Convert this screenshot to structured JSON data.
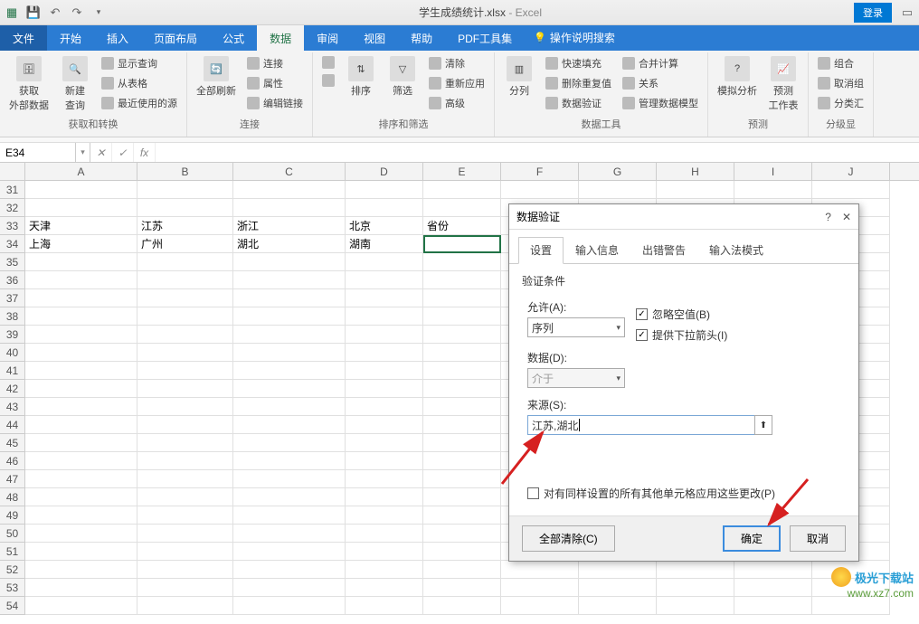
{
  "title": {
    "doc": "学生成绩统计.xlsx",
    "app": "Excel"
  },
  "login": "登录",
  "tabs": {
    "file": "文件",
    "home": "开始",
    "insert": "插入",
    "layout": "页面布局",
    "formulas": "公式",
    "data": "数据",
    "review": "审阅",
    "view": "视图",
    "help": "帮助",
    "pdf": "PDF工具集",
    "tellme": "操作说明搜索"
  },
  "ribbon": {
    "g1": {
      "label": "获取和转换",
      "getExternal": "获取\n外部数据",
      "newQuery": "新建\n查询",
      "showQueries": "显示查询",
      "fromTable": "从表格",
      "recentSources": "最近使用的源"
    },
    "g2": {
      "label": "连接",
      "refreshAll": "全部刷新",
      "connections": "连接",
      "properties": "属性",
      "editLinks": "编辑链接"
    },
    "g3": {
      "label": "排序和筛选",
      "sortAZ": "A↓Z",
      "sortZA": "Z↓A",
      "sort": "排序",
      "filter": "筛选",
      "clear": "清除",
      "reapply": "重新应用",
      "advanced": "高级"
    },
    "g4": {
      "label": "数据工具",
      "textToCols": "分列",
      "flashFill": "快速填充",
      "removeDup": "删除重复值",
      "dataValidation": "数据验证",
      "consolidate": "合并计算",
      "relations": "关系",
      "manageModel": "管理数据模型"
    },
    "g5": {
      "label": "预测",
      "whatIf": "模拟分析",
      "forecast": "预测\n工作表"
    },
    "g6": {
      "label": "分级显",
      "group": "组合",
      "ungroup": "取消组",
      "subtotal": "分类汇"
    }
  },
  "namebox": "E34",
  "columns": [
    "A",
    "B",
    "C",
    "D",
    "E",
    "F",
    "G",
    "H",
    "I",
    "J"
  ],
  "rows": {
    "31": [
      "",
      "",
      "",
      "",
      "",
      "",
      "",
      "",
      "",
      ""
    ],
    "32": [
      "",
      "",
      "",
      "",
      "",
      "",
      "",
      "",
      "",
      ""
    ],
    "33": [
      "天津",
      "江苏",
      "浙江",
      "北京",
      "省份",
      "",
      "",
      "",
      "",
      ""
    ],
    "34": [
      "上海",
      "广州",
      "湖北",
      "湖南",
      "",
      "",
      "",
      "",
      "",
      ""
    ],
    "35": [
      "",
      "",
      "",
      "",
      "",
      "",
      "",
      "",
      "",
      ""
    ],
    "36": [
      "",
      "",
      "",
      "",
      "",
      "",
      "",
      "",
      "",
      ""
    ],
    "37": [
      "",
      "",
      "",
      "",
      "",
      "",
      "",
      "",
      "",
      ""
    ],
    "38": [
      "",
      "",
      "",
      "",
      "",
      "",
      "",
      "",
      "",
      ""
    ],
    "39": [
      "",
      "",
      "",
      "",
      "",
      "",
      "",
      "",
      "",
      ""
    ],
    "40": [
      "",
      "",
      "",
      "",
      "",
      "",
      "",
      "",
      "",
      ""
    ],
    "41": [
      "",
      "",
      "",
      "",
      "",
      "",
      "",
      "",
      "",
      ""
    ],
    "42": [
      "",
      "",
      "",
      "",
      "",
      "",
      "",
      "",
      "",
      ""
    ],
    "43": [
      "",
      "",
      "",
      "",
      "",
      "",
      "",
      "",
      "",
      ""
    ],
    "44": [
      "",
      "",
      "",
      "",
      "",
      "",
      "",
      "",
      "",
      ""
    ],
    "45": [
      "",
      "",
      "",
      "",
      "",
      "",
      "",
      "",
      "",
      ""
    ],
    "46": [
      "",
      "",
      "",
      "",
      "",
      "",
      "",
      "",
      "",
      ""
    ],
    "47": [
      "",
      "",
      "",
      "",
      "",
      "",
      "",
      "",
      "",
      ""
    ],
    "48": [
      "",
      "",
      "",
      "",
      "",
      "",
      "",
      "",
      "",
      ""
    ],
    "49": [
      "",
      "",
      "",
      "",
      "",
      "",
      "",
      "",
      "",
      ""
    ],
    "50": [
      "",
      "",
      "",
      "",
      "",
      "",
      "",
      "",
      "",
      ""
    ],
    "51": [
      "",
      "",
      "",
      "",
      "",
      "",
      "",
      "",
      "",
      ""
    ],
    "52": [
      "",
      "",
      "",
      "",
      "",
      "",
      "",
      "",
      "",
      ""
    ],
    "53": [
      "",
      "",
      "",
      "",
      "",
      "",
      "",
      "",
      "",
      ""
    ],
    "54": [
      "",
      "",
      "",
      "",
      "",
      "",
      "",
      "",
      "",
      ""
    ]
  },
  "dialog": {
    "title": "数据验证",
    "help": "?",
    "close": "✕",
    "tabs": {
      "settings": "设置",
      "inputMsg": "输入信息",
      "errorAlert": "出错警告",
      "ime": "输入法模式"
    },
    "criteriaLabel": "验证条件",
    "allowLabel": "允许(A):",
    "allowValue": "序列",
    "ignoreBlank": "忽略空值(B)",
    "inCellDropdown": "提供下拉箭头(I)",
    "dataLabel": "数据(D):",
    "dataValue": "介于",
    "sourceLabel": "来源(S):",
    "sourceValue": "江苏,湖北",
    "applyAll": "对有同样设置的所有其他单元格应用这些更改(P)",
    "clearAll": "全部清除(C)",
    "ok": "确定",
    "cancel": "取消"
  },
  "watermark": {
    "line1": "极光下载站",
    "line2": "www.xz7.com"
  }
}
